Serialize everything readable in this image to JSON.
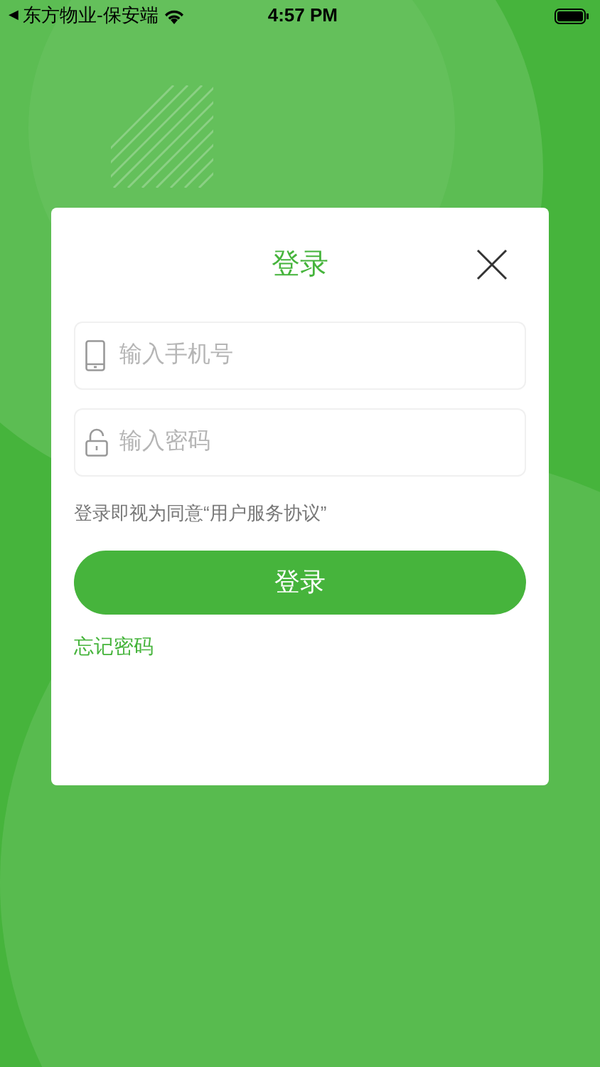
{
  "status_bar": {
    "back_arrow": "◀",
    "back_label": "东方物业-保安端",
    "time": "4:57 PM"
  },
  "dialog": {
    "title": "登录",
    "fields": [
      {
        "kind": "phone",
        "placeholder": "输入手机号"
      },
      {
        "kind": "password",
        "placeholder": "输入密码"
      }
    ],
    "agreement": "登录即视为同意“用户服务协议”",
    "submit": "登录",
    "forgot": "忘记密码"
  }
}
